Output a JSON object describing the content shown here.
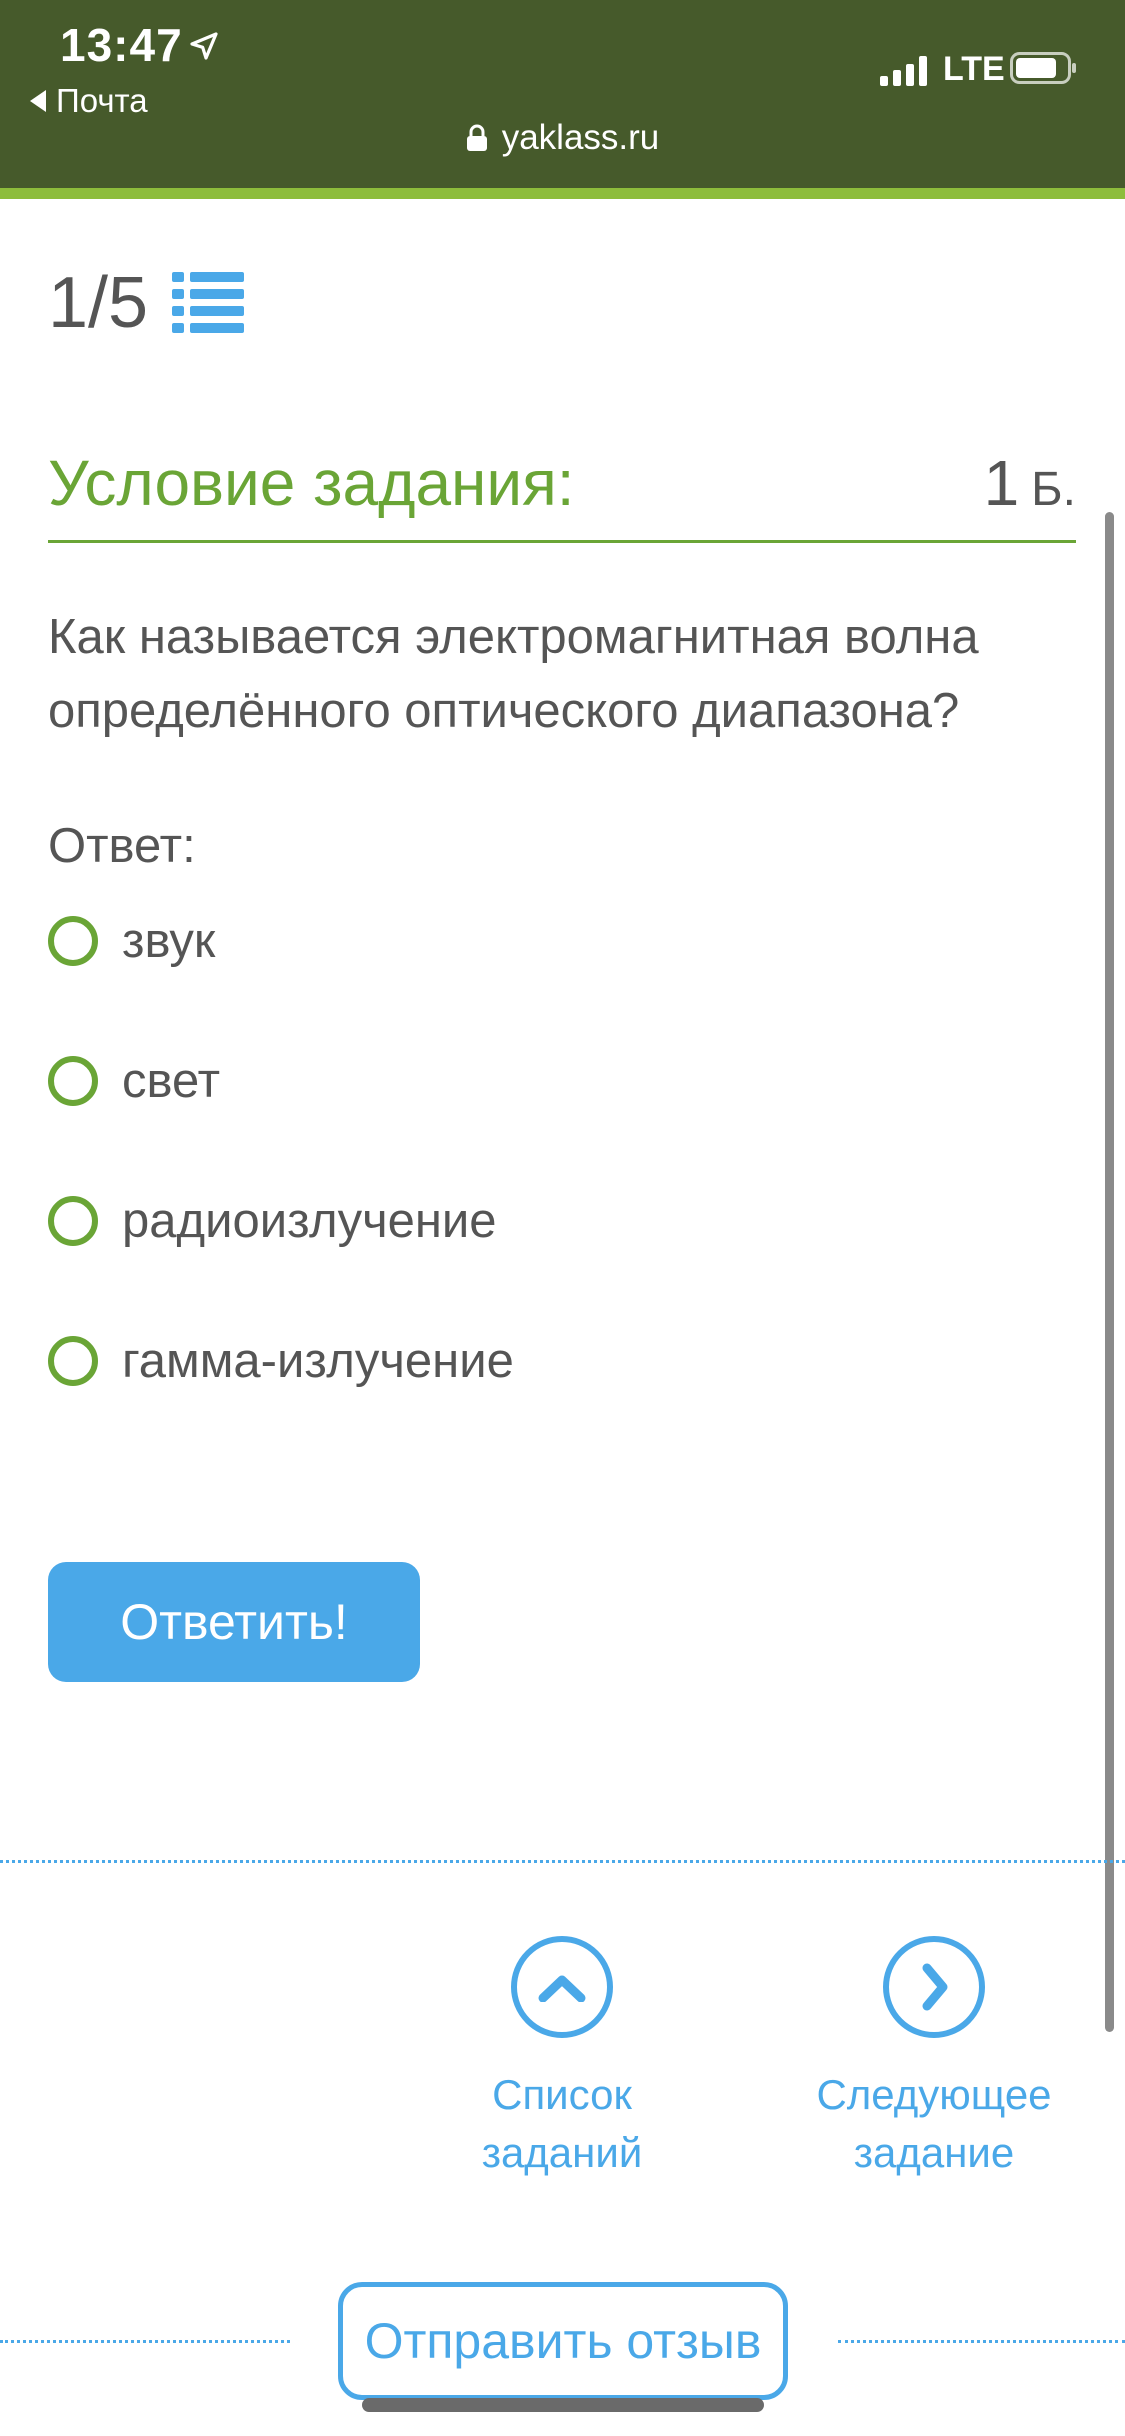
{
  "status_bar": {
    "time": "13:47",
    "back_label": "Почта",
    "carrier": "LTE",
    "url": "yaklass.ru"
  },
  "counter": {
    "text": "1/5"
  },
  "task": {
    "title": "Условие задания:",
    "points": "1",
    "points_unit": "Б.",
    "question": "Как называется электромагнитная волна определённого оптического диапазона?",
    "answer_label": "Ответ:",
    "options": [
      {
        "label": "звук"
      },
      {
        "label": "свет"
      },
      {
        "label": "радиоизлучение"
      },
      {
        "label": "гамма-излучение"
      }
    ],
    "submit_label": "Ответить!"
  },
  "nav": {
    "list_label": "Список\nзаданий",
    "next_label": "Следующее\nзадание"
  },
  "feedback": {
    "label": "Отправить отзыв"
  },
  "colors": {
    "topbar": "#465a2b",
    "accent_green": "#6aa536",
    "accent_blue": "#4aa8e8",
    "text": "#555555"
  }
}
